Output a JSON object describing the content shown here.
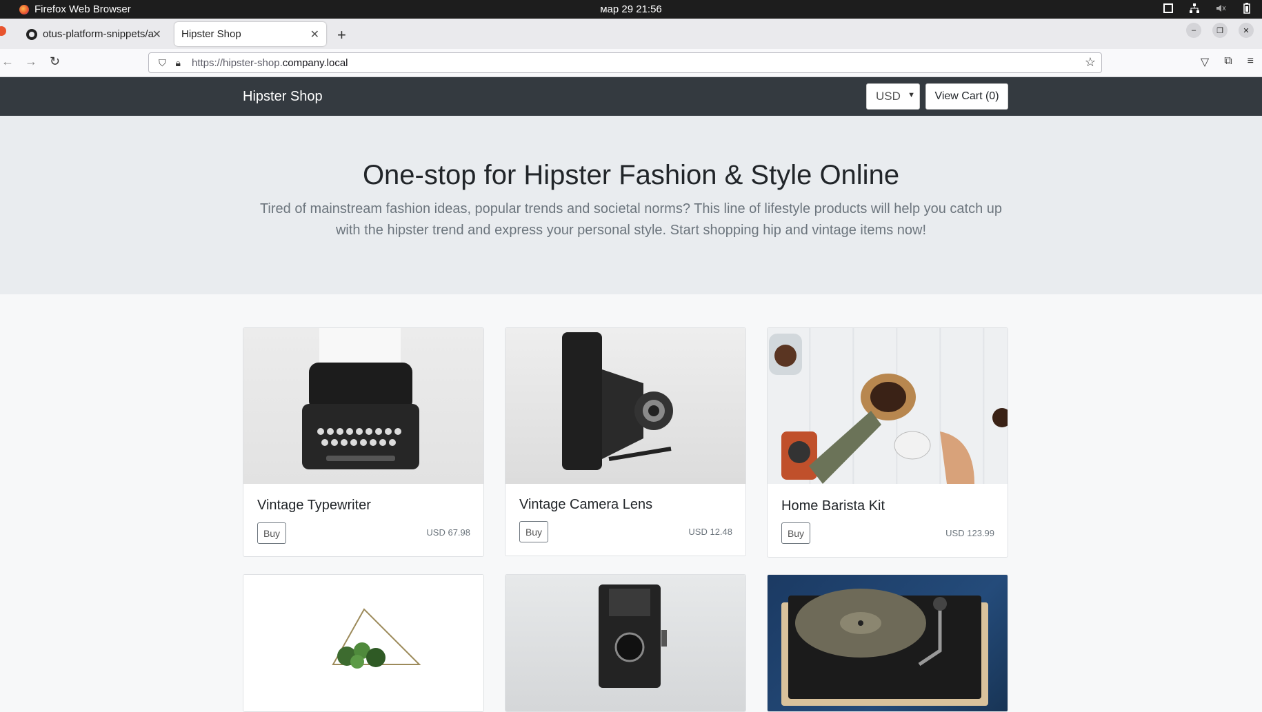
{
  "os": {
    "app_name": "Firefox Web Browser",
    "clock": "мар 29  21:56"
  },
  "browser": {
    "tabs": [
      {
        "label": "otus-platform-snippets/a",
        "active": false,
        "icon": "github-icon"
      },
      {
        "label": "Hipster Shop",
        "active": true,
        "icon": ""
      }
    ],
    "url_prefix": "https://hipster-shop.",
    "url_host": "company.local"
  },
  "site": {
    "brand": "Hipster Shop",
    "currency": "USD",
    "cart_label": "View Cart (0)"
  },
  "hero": {
    "title": "One-stop for Hipster Fashion & Style Online",
    "subtitle": "Tired of mainstream fashion ideas, popular trends and societal norms? This line of lifestyle products will help you catch up with the hipster trend and express your personal style. Start shopping hip and vintage items now!"
  },
  "products": [
    {
      "name": "Vintage Typewriter",
      "buy": "Buy",
      "price": "USD 67.98"
    },
    {
      "name": "Vintage Camera Lens",
      "buy": "Buy",
      "price": "USD 12.48"
    },
    {
      "name": "Home Barista Kit",
      "buy": "Buy",
      "price": "USD 123.99"
    },
    {
      "name": "",
      "buy": "",
      "price": ""
    },
    {
      "name": "",
      "buy": "",
      "price": ""
    },
    {
      "name": "",
      "buy": "",
      "price": ""
    }
  ],
  "colors": {
    "header_bg": "#343a40",
    "hero_bg": "#e9ecef",
    "page_bg": "#f7f8f9"
  }
}
